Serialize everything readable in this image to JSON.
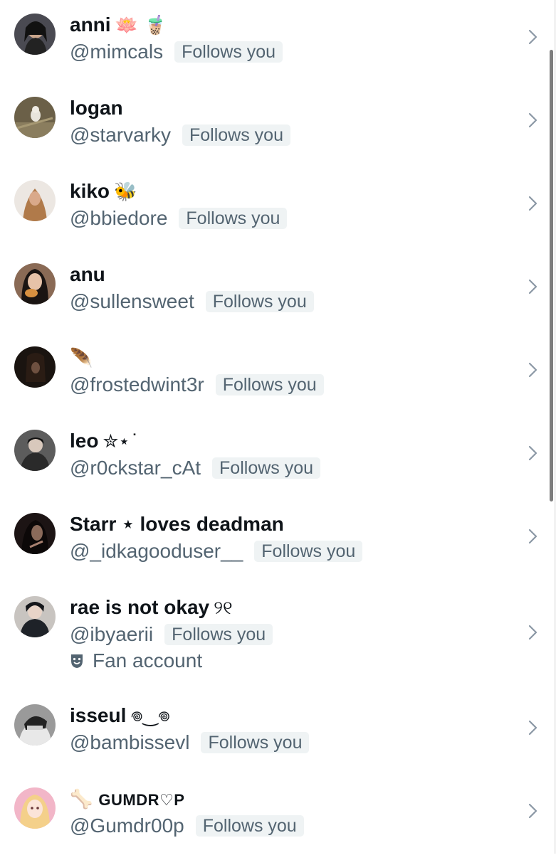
{
  "users": [
    {
      "name": "anni",
      "emoji": "🪷 🧋",
      "handle": "@mimcals",
      "badge": "Follows you",
      "avatar_bg": "#4a4a52"
    },
    {
      "name": "logan",
      "emoji": "",
      "handle": "@starvarky",
      "badge": "Follows you",
      "avatar_bg": "#6b6048"
    },
    {
      "name": "kiko",
      "emoji": "🐝",
      "handle": "@bbiedore",
      "badge": "Follows you",
      "avatar_bg": "#d9c6b4"
    },
    {
      "name": "anu",
      "emoji": "",
      "handle": "@sullensweet",
      "badge": "Follows you",
      "avatar_bg": "#8a6a55"
    },
    {
      "name": "",
      "emoji": "🪶",
      "handle": "@frostedwint3r",
      "badge": "Follows you",
      "avatar_bg": "#1a1410"
    },
    {
      "name": "leo",
      "emoji": "✮⋆˙",
      "handle": "@r0ckstar_cAt",
      "badge": "Follows you",
      "avatar_bg": "#5c5c5c"
    },
    {
      "name": "Starr ⋆ loves deadman",
      "emoji": "",
      "handle": "@_idkagooduser__",
      "badge": "Follows you",
      "avatar_bg": "#1c1414"
    },
    {
      "name": "rae is not okay",
      "emoji": "୨୧",
      "handle": "@ibyaerii",
      "badge": "Follows you",
      "avatar_bg": "#3a3a40",
      "bio": "Fan account"
    },
    {
      "name": "isseul",
      "emoji": "𖦹‿𖦹",
      "handle": "@bambissevl",
      "badge": "Follows you",
      "avatar_bg": "#7a7a7a"
    },
    {
      "name": "GUMDR♡P",
      "emoji": "🦴",
      "handle": "@Gumdr00p",
      "badge": "Follows you",
      "avatar_bg": "#f2b6c8"
    }
  ],
  "icons": {
    "chevron": "chevron-right-icon",
    "bio": "theater-mask-icon"
  },
  "colors": {
    "name": "#0f1419",
    "secondary": "#536471",
    "badge_bg": "#eff3f4",
    "chevron": "#8b98a5"
  }
}
